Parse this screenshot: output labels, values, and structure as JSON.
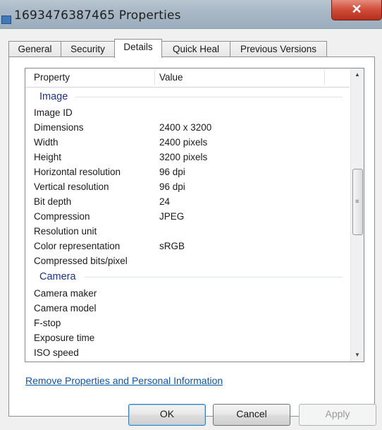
{
  "window": {
    "title": "1693476387465 Properties",
    "close_label": "✕"
  },
  "tabs": [
    {
      "label": "General"
    },
    {
      "label": "Security"
    },
    {
      "label": "Details"
    },
    {
      "label": "Quick Heal"
    },
    {
      "label": "Previous Versions"
    }
  ],
  "active_tab": "Details",
  "list": {
    "headers": {
      "property": "Property",
      "value": "Value"
    },
    "image_group": "Image",
    "image_rows": [
      {
        "name": "Image ID",
        "value": ""
      },
      {
        "name": "Dimensions",
        "value": "2400 x 3200"
      },
      {
        "name": "Width",
        "value": "2400 pixels"
      },
      {
        "name": "Height",
        "value": "3200 pixels"
      },
      {
        "name": "Horizontal resolution",
        "value": "96 dpi"
      },
      {
        "name": "Vertical resolution",
        "value": "96 dpi"
      },
      {
        "name": "Bit depth",
        "value": "24"
      },
      {
        "name": "Compression",
        "value": "JPEG"
      },
      {
        "name": "Resolution unit",
        "value": ""
      },
      {
        "name": "Color representation",
        "value": "sRGB"
      },
      {
        "name": "Compressed bits/pixel",
        "value": ""
      }
    ],
    "camera_group": "Camera",
    "camera_rows": [
      {
        "name": "Camera maker",
        "value": ""
      },
      {
        "name": "Camera model",
        "value": ""
      },
      {
        "name": "F-stop",
        "value": ""
      },
      {
        "name": "Exposure time",
        "value": ""
      },
      {
        "name": "ISO speed",
        "value": ""
      }
    ]
  },
  "remove_link": "Remove Properties and Personal Information",
  "buttons": {
    "ok": "OK",
    "cancel": "Cancel",
    "apply": "Apply"
  },
  "colors": {
    "group_heading": "#1e3287",
    "link": "#0b56a6",
    "close_button": "#c7432f"
  }
}
